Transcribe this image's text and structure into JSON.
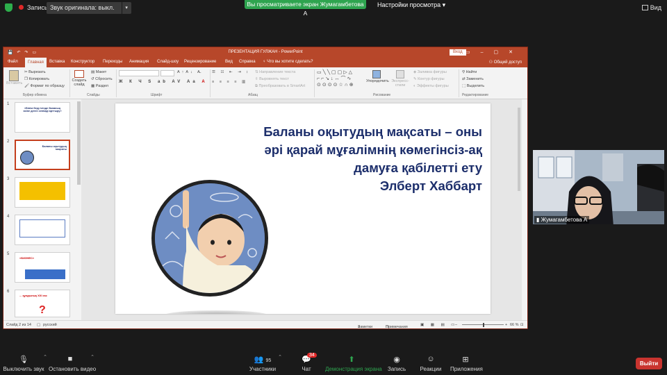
{
  "zoom_top": {
    "record_label": "Запись",
    "original_sound": "Звук оригинала: выкл.",
    "share_banner": "Вы просматриваете экран Жумагамбетова А",
    "view_options": "Настройки просмотра",
    "view_mode": "Вид"
  },
  "ppt": {
    "title": "ПРЕЗЕНТАЦИЯ ГУЛЖАН  -  PowerPoint",
    "signin": "Вход",
    "tabs": [
      "Файл",
      "Главная",
      "Вставка",
      "Конструктор",
      "Переходы",
      "Анимация",
      "Слайд-шоу",
      "Рецензирование",
      "Вид",
      "Справка",
      "Что вы хотите сделать?"
    ],
    "active_tab": "Главная",
    "share": "Общий доступ",
    "ribbon": {
      "paste": "Вставить",
      "cut": "Вырезать",
      "copy": "Копировать",
      "format_painter": "Формат по образцу",
      "clipboard": "Буфер обмена",
      "new_slide": "Создать слайд",
      "layout": "Макет",
      "reset": "Сбросить",
      "section": "Раздел",
      "slides": "Слайды",
      "font": "Шрифт",
      "text_direction": "Направление текста",
      "align_text": "Выровнять текст",
      "convert_smartart": "Преобразовать в SmartArt",
      "paragraph": "Абзац",
      "arrange": "Упорядочить",
      "quick_styles": "Экспресс-стили",
      "shape_fill": "Заливка фигуры",
      "shape_outline": "Контур фигуры",
      "shape_effects": "Эффекты фигуры",
      "drawing": "Рисование",
      "find": "Найти",
      "replace": "Заменить",
      "select": "Выделить",
      "editing": "Редактирование"
    },
    "thumbs": [
      {
        "num": "1",
        "text": "«Білім беру ісінде баланың өзіне деген сенімді арттыру»"
      },
      {
        "num": "2",
        "text": "Баланы оқытудың мақсаты"
      },
      {
        "num": "3",
        "text": ""
      },
      {
        "num": "4",
        "text": ""
      },
      {
        "num": "5",
        "text": "«БИЗНЕС»"
      },
      {
        "num": "6",
        "text": "... құндылық ХХІ ғас"
      }
    ],
    "slide": {
      "quote_line1": "Баланы оқытудың мақсаты – оны",
      "quote_line2": "әрі қарай мұғалімнің көмегінсіз-ақ",
      "quote_line3": "дамуға қабілетті ету ",
      "quote_line4": "Элберт Хаббарт"
    },
    "status": {
      "slide_info": "Слайд 2 из 14",
      "language": "русский",
      "notes": "Заметки",
      "comments": "Примечания",
      "zoom": "66 %"
    }
  },
  "video": {
    "name": "Жумагамбетова А"
  },
  "zoom_bottom": {
    "mute": "Выключить звук",
    "video": "Остановить видео",
    "participants": "Участники",
    "participants_count": "95",
    "chat": "Чат",
    "chat_badge": "34",
    "share": "Демонстрация экрана",
    "record": "Запись",
    "reactions": "Реакции",
    "apps": "Приложения",
    "leave": "Выйти"
  },
  "colors": {
    "ppt_accent": "#b7472a",
    "quote_text": "#1c2e6b",
    "zoom_green": "#2ea44f",
    "leave_red": "#c9342f"
  }
}
